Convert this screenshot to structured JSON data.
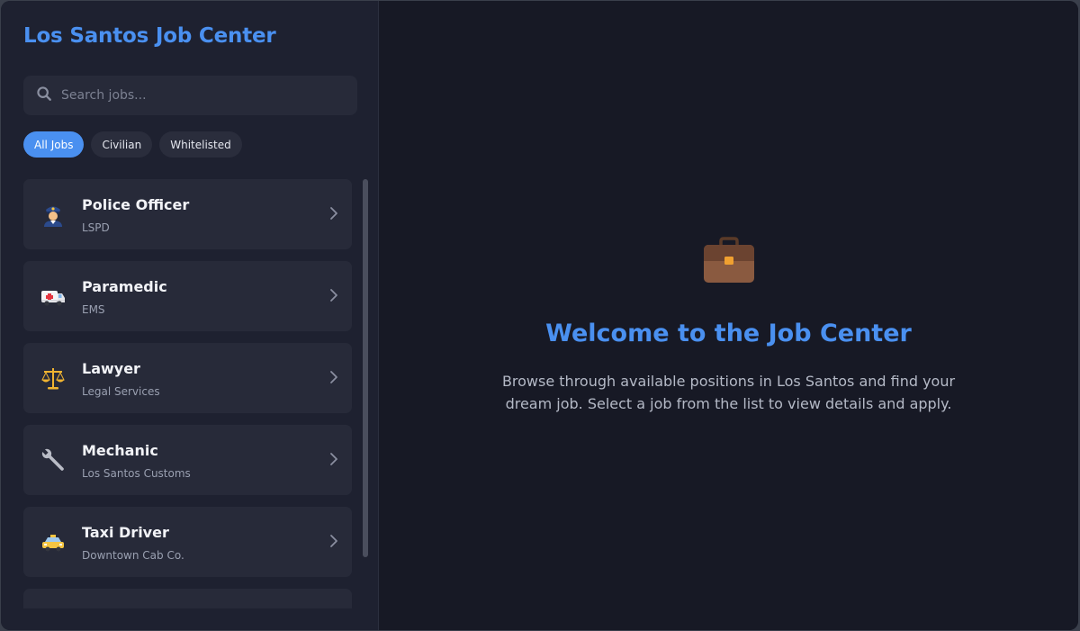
{
  "app": {
    "title": "Los Santos Job Center"
  },
  "search": {
    "placeholder": "Search jobs..."
  },
  "filters": [
    {
      "label": "All Jobs",
      "active": true
    },
    {
      "label": "Civilian",
      "active": false
    },
    {
      "label": "Whitelisted",
      "active": false
    }
  ],
  "jobs": [
    {
      "name": "Police Officer",
      "department": "LSPD",
      "icon": "police-officer-icon"
    },
    {
      "name": "Paramedic",
      "department": "EMS",
      "icon": "ambulance-icon"
    },
    {
      "name": "Lawyer",
      "department": "Legal Services",
      "icon": "scales-icon"
    },
    {
      "name": "Mechanic",
      "department": "Los Santos Customs",
      "icon": "wrench-icon"
    },
    {
      "name": "Taxi Driver",
      "department": "Downtown Cab Co.",
      "icon": "taxi-icon"
    }
  ],
  "welcome": {
    "icon": "briefcase-icon",
    "title": "Welcome to the Job Center",
    "text": "Browse through available positions in Los Santos and find your dream job. Select a job from the list to view details and apply."
  },
  "colors": {
    "accent": "#4a90f0",
    "sidebar_bg": "#1e2130",
    "main_bg": "#171925",
    "card_bg": "#272a39"
  }
}
